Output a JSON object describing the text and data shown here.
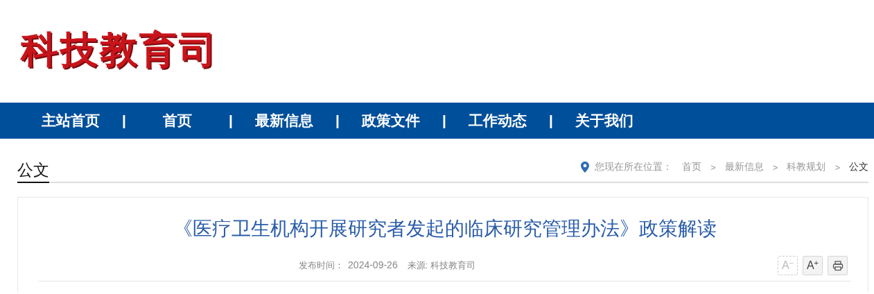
{
  "logo": {
    "text": "科技教育司"
  },
  "nav": {
    "items": [
      {
        "label": "主站首页"
      },
      {
        "label": "首页"
      },
      {
        "label": "最新信息"
      },
      {
        "label": "政策文件"
      },
      {
        "label": "工作动态"
      },
      {
        "label": "关于我们"
      }
    ],
    "separator": "|"
  },
  "section": {
    "title": "公文"
  },
  "breadcrumb": {
    "prefix": "您现在所在位置：",
    "items": [
      "首页",
      "最新信息",
      "科教规划",
      "公文"
    ],
    "separator": ">"
  },
  "article": {
    "title": "《医疗卫生机构开展研究者发起的临床研究管理办法》政策解读",
    "date_label": "发布时间：",
    "date": "2024-09-26",
    "source": "来源: 科技教育司",
    "tools": [
      {
        "kind": "text-size",
        "label": "A",
        "sign": "−",
        "disabled": true
      },
      {
        "kind": "text-size",
        "label": "A",
        "sign": "+",
        "disabled": false
      },
      {
        "kind": "print",
        "disabled": false
      }
    ]
  }
}
